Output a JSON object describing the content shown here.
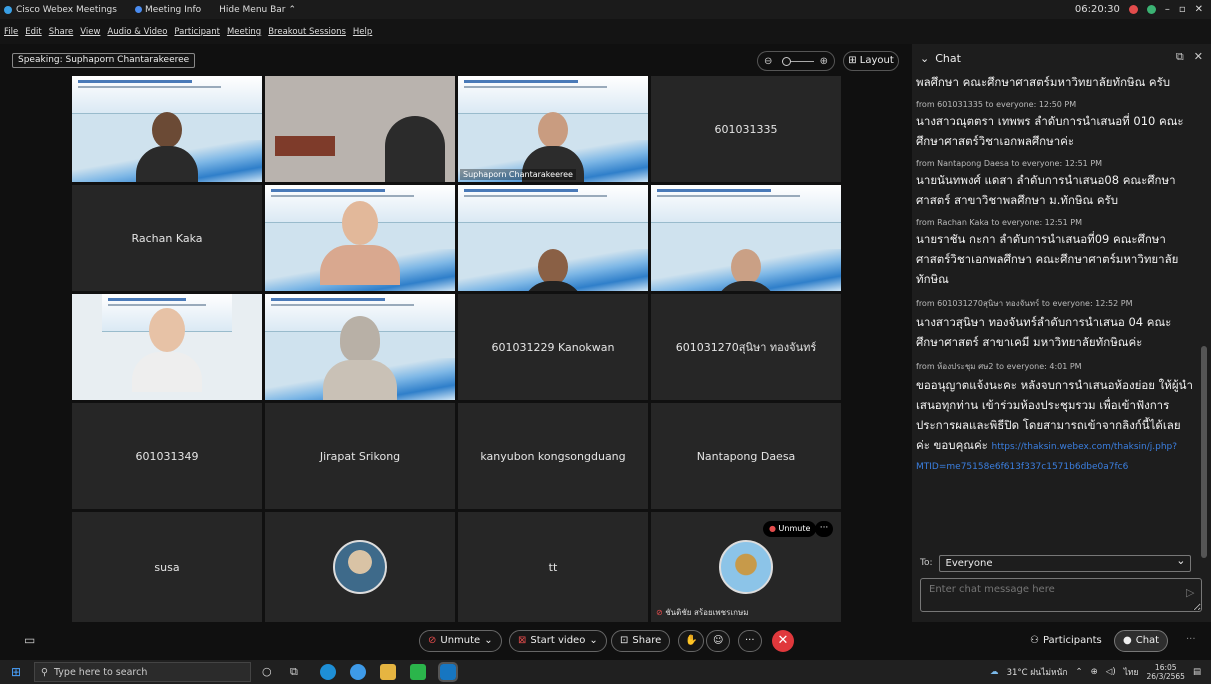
{
  "titlebar": {
    "app_title": "Cisco Webex Meetings",
    "meeting_info": "Meeting Info",
    "hide_menu": "Hide Menu Bar",
    "clock": "06:20:30"
  },
  "menu": [
    "File",
    "Edit",
    "Share",
    "View",
    "Audio & Video",
    "Participant",
    "Meeting",
    "Breakout Sessions",
    "Help"
  ],
  "speaking": "Speaking: Suphaporn Chantarakeeree",
  "layout_label": "Layout",
  "tiles": [
    {
      "name": "",
      "video": true
    },
    {
      "name": "",
      "video": true
    },
    {
      "name": "Suphaporn Chantarakeeree",
      "video": true
    },
    {
      "name": "601031335",
      "video": false
    },
    {
      "name": "Rachan Kaka",
      "video": false
    },
    {
      "name": "",
      "video": true
    },
    {
      "name": "",
      "video": true
    },
    {
      "name": "",
      "video": true
    },
    {
      "name": "",
      "video": true
    },
    {
      "name": "",
      "video": true
    },
    {
      "name": "601031229 Kanokwan",
      "video": false
    },
    {
      "name": "601031270สุนิษา ทองจันทร์",
      "video": false
    },
    {
      "name": "601031349",
      "video": false
    },
    {
      "name": "Jirapat Srikong",
      "video": false
    },
    {
      "name": "kanyubon kongsongduang",
      "video": false
    },
    {
      "name": "Nantapong Daesa",
      "video": false
    },
    {
      "name": "susa",
      "video": false
    },
    {
      "name": "",
      "video": false
    },
    {
      "name": "tt",
      "video": false
    },
    {
      "name": "ชันติชัย สร้อยเพชรเกษม",
      "video": false
    }
  ],
  "tile_unmute": "Unmute",
  "tile_more": "···",
  "chat": {
    "title": "Chat",
    "messages": [
      {
        "meta": "",
        "text": "พลศึกษา คณะศึกษาศาสตร์มหาวิทยาลัยทักษิณ ครับ"
      },
      {
        "meta": "from 601031335 to everyone:   12:50 PM",
        "text": "นางสาวณุตตรา เทพพร ลำดับการนำเสนอที่ 010 คณะศึกษาศาสตร์วิชาเอกพลศึกษาค่ะ"
      },
      {
        "meta": "from Nantapong Daesa to everyone:   12:51 PM",
        "text": "นายนันทพงศ์ แดสา ลำดับการนำเสนอ08 คณะศึกษาศาสตร์ สาขาวิชาพลศึกษา ม.ทักษิณ ครับ"
      },
      {
        "meta": "from Rachan Kaka to everyone:   12:51 PM",
        "text": "นายราชัน กะกา ลำดับการนำเสนอที่09 คณะศึกษาศาสตร์วิชาเอกพลศึกษา คณะศึกษาศาตร์มหาวิทยาลัยทักษิณ"
      },
      {
        "meta": "from 601031270สุนิษา ทองจันทร์ to everyone:   12:52 PM",
        "text": "นางสาวสุนิษา ทองจันทร์ลำดับการนำเสนอ 04 คณะศึกษาศาสตร์ สาขาเคมี มหาวิทยาลัยทักษิณค่ะ"
      },
      {
        "meta": "from ห้องประชุม ศษ2 to everyone:   4:01 PM",
        "text": "ขออนุญาตแจ้งนะคะ หลังจบการนำเสนอห้องย่อย ให้ผู้นำเสนอทุกท่าน เข้าร่วมห้องประชุมรวม เพื่อเข้าฟังการประการผลและพิธีปิด โดยสามารถเข้าจากลิงก์นี้ได้เลยค่ะ ขอบคุณค่ะ",
        "link": "https://thaksin.webex.com/thaksin/j.php?MTID=me75158e6f613f337c1571b6dbe0a7fc6"
      }
    ],
    "to_label": "To:",
    "to_value": "Everyone",
    "input_placeholder": "Enter chat message here"
  },
  "controls": {
    "unmute": "Unmute",
    "start_video": "Start video",
    "share": "Share",
    "participants": "Participants",
    "chat": "Chat"
  },
  "taskbar": {
    "search_placeholder": "Type here to search",
    "weather": "31°C ฝนไม่หนัก",
    "lang": "ไทย",
    "time": "16:05",
    "date": "26/3/2565"
  }
}
